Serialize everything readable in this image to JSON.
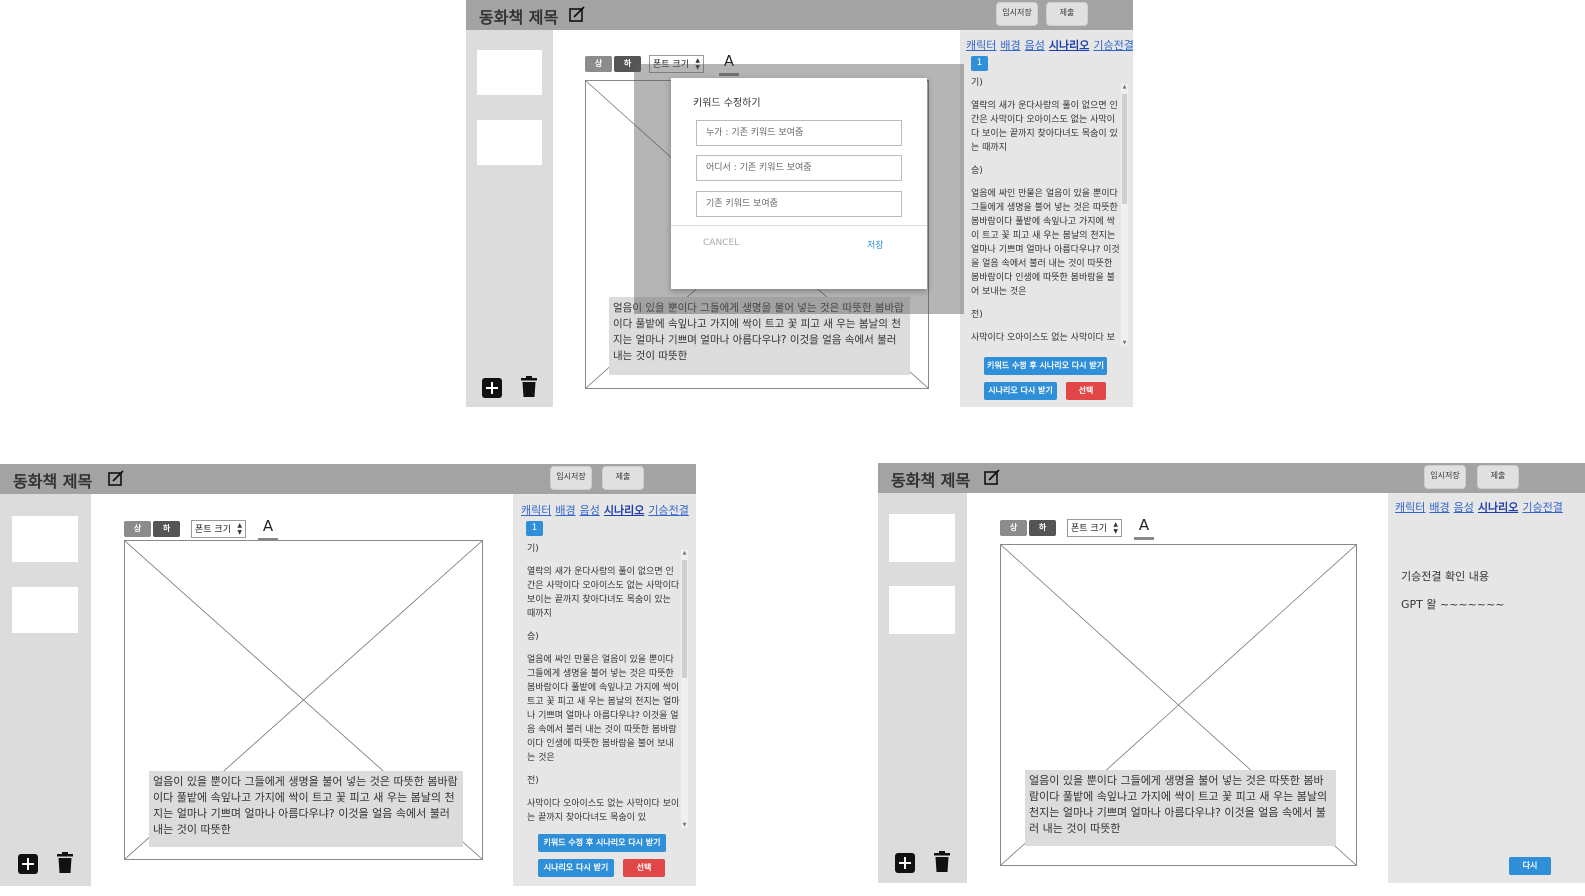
{
  "app": {
    "title": "동화책 제목",
    "save_temp": "임시저장",
    "submit": "제출"
  },
  "toolbar": {
    "upper": "상",
    "lower": "하",
    "font_size": "폰트 크기",
    "color_letter": "A"
  },
  "tabs": [
    "캐릭터",
    "배경",
    "음성",
    "시나리오",
    "기승전결"
  ],
  "active_tab": "시나리오",
  "page_number": "1",
  "scenario": {
    "gi_label": "기)",
    "gi_text": "열락의 새가 운다사랑의 풀이 없으면 인간은 사막이다 오아이스도 없는 사막이다 보이는 끝까지 찾아다녀도 목숨이 있는 때까지",
    "seung_label": "승)",
    "seung_text": "얼음에 싸인 만물은 얼음이 있을 뿐이다 그들에게 생명을 불어 넣는 것은 따뜻한 봄바람이다 풀밭에 속잎나고 가지에 싹이 트고 꽃 피고 새 우는 봄날의 천지는 얼마나 기쁘며 얼마나 아름다우냐? 이것을 얼음 속에서 불러 내는 것이 따뜻한 봄바람이다 인생에 따뜻한 봄바람을 불어 보내는 것은",
    "jeon_label": "전)",
    "jeon_text": "사막이다 오아이스도 없는 사막이다 보이는 끝까지 찾아다녀도 목숨이 있"
  },
  "story_text": "얼음이 있을 뿐이다 그들에게 생명을 불어 넣는 것은 따뜻한 봄바람이다 풀밭에 속잎나고 가지에 싹이 트고 꽃 피고 새 우는 봄날의 천지는 얼마나 기쁘며 얼마나 아름다우냐? 이것을 얼음 속에서 불러 내는 것이 따뜻한",
  "buttons": {
    "regen_after_edit": "키워드 수정 후 시나리오 다시 받기",
    "regen": "시나리오 다시 받기",
    "select": "선택",
    "again": "다시"
  },
  "modal": {
    "title": "키워드 수정하기",
    "field_who": "누가 : 기존 키워드 보여줌",
    "field_where": "어디서 : 기존 키워드 보여줌",
    "field_other": "기존 키워드 보여줌",
    "cancel": "CANCEL",
    "save": "저장"
  },
  "confirm": {
    "heading": "기승전결 확인 내용",
    "gpt": "GPT 왈 ~~~~~~~"
  },
  "colors": {
    "topbar": "#a3a3a3",
    "sidebar": "#dcdcdc",
    "panel": "#e6e6e6",
    "blue": "#2f8fd8",
    "red": "#e24646",
    "link": "#3366cc"
  }
}
